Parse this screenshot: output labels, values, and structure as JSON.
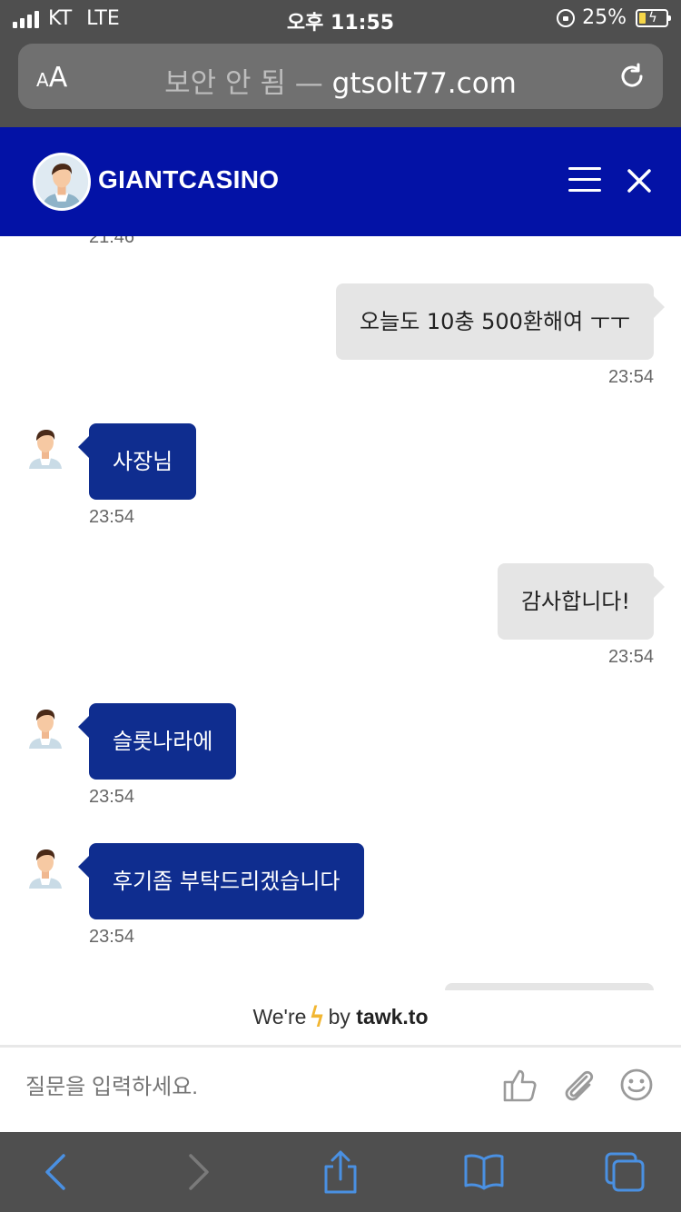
{
  "status": {
    "carrier": "KT",
    "network": "LTE",
    "time": "오후 11:55",
    "battery": "25%",
    "battery_level": 0.25
  },
  "browser": {
    "aa_small": "A",
    "aa_large": "A",
    "security": "보안 안 됨 —",
    "domain": "gtsolt77.com"
  },
  "header": {
    "title": "GIANTCASINO"
  },
  "messages": [
    {
      "side": "in",
      "text": "",
      "time": "21:46"
    },
    {
      "side": "out",
      "text": "오늘도 10충 500환해여 ㅜㅜ",
      "time": "23:54"
    },
    {
      "side": "in",
      "text": "사장님",
      "time": "23:54"
    },
    {
      "side": "out",
      "text": "감사합니다!",
      "time": "23:54"
    },
    {
      "side": "in",
      "text": "슬롯나라에",
      "time": "23:54"
    },
    {
      "side": "in",
      "text": "후기좀 부탁드리겠습니다",
      "time": "23:54"
    }
  ],
  "powered": {
    "prefix": "We're",
    "by": "by",
    "brand": "tawk.to"
  },
  "composer": {
    "placeholder": "질문을 입력하세요."
  },
  "colors": {
    "header_bg": "#0312a6",
    "agent_bubble": "#0f2d8f",
    "visitor_bubble": "#e5e5e5",
    "toolbar_icon": "#4a90e2"
  }
}
